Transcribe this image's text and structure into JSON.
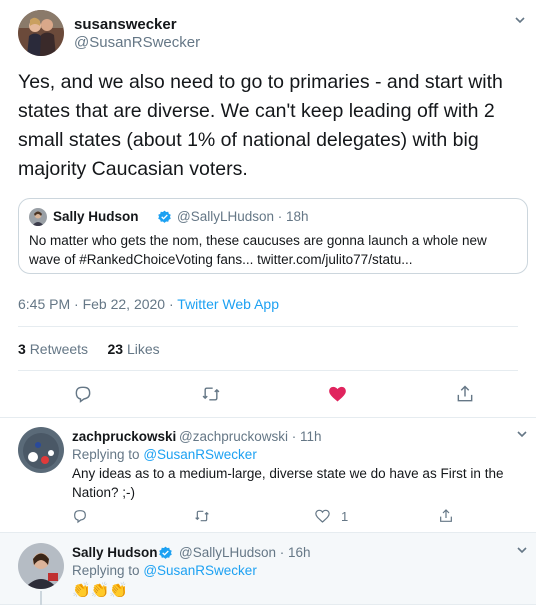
{
  "main_tweet": {
    "name": "susanswecker",
    "handle": "@SusanRSwecker",
    "text": "Yes, and we also need to go to primaries - and start with states that are diverse. We can't keep leading off with 2 small states (about 1% of national delegates) with big majority Caucasian voters.",
    "quote": {
      "name": "Sally Hudson",
      "handle": "@SallyLHudson · 18h",
      "text": "No matter who gets the nom, these caucuses are gonna launch a whole new wave of #RankedChoiceVoting fans... twitter.com/julito77/statu..."
    },
    "time": "6:45 PM · Feb 22, 2020",
    "separator": " · ",
    "source": "Twitter Web App",
    "retweets_count": "3",
    "retweets_label": "Retweets",
    "likes_count": "23",
    "likes_label": "Likes",
    "liked": true,
    "like_color": "#e0245e"
  },
  "replies": [
    {
      "name": "zachpruckowski",
      "handle": "@zachpruckowski · 11h",
      "replying_prefix": "Replying to",
      "replying_to": "@SusanRSwecker",
      "text": "Any ideas as to a medium-large, diverse state we do have as First in the Nation? ;-)",
      "like_count": "1"
    },
    {
      "name": "Sally Hudson",
      "handle": "@SallyLHudson · 16h",
      "replying_prefix": "Replying to",
      "replying_to": "@SusanRSwecker",
      "text": "👏👏👏"
    }
  ],
  "colors": {
    "accent": "#1da1f2",
    "muted": "#657786",
    "text": "#14171a",
    "border": "#e6ecf0"
  },
  "icons": [
    "chevron-down-icon",
    "verified-icon",
    "reply-icon",
    "retweet-icon",
    "heart-icon",
    "share-icon"
  ]
}
